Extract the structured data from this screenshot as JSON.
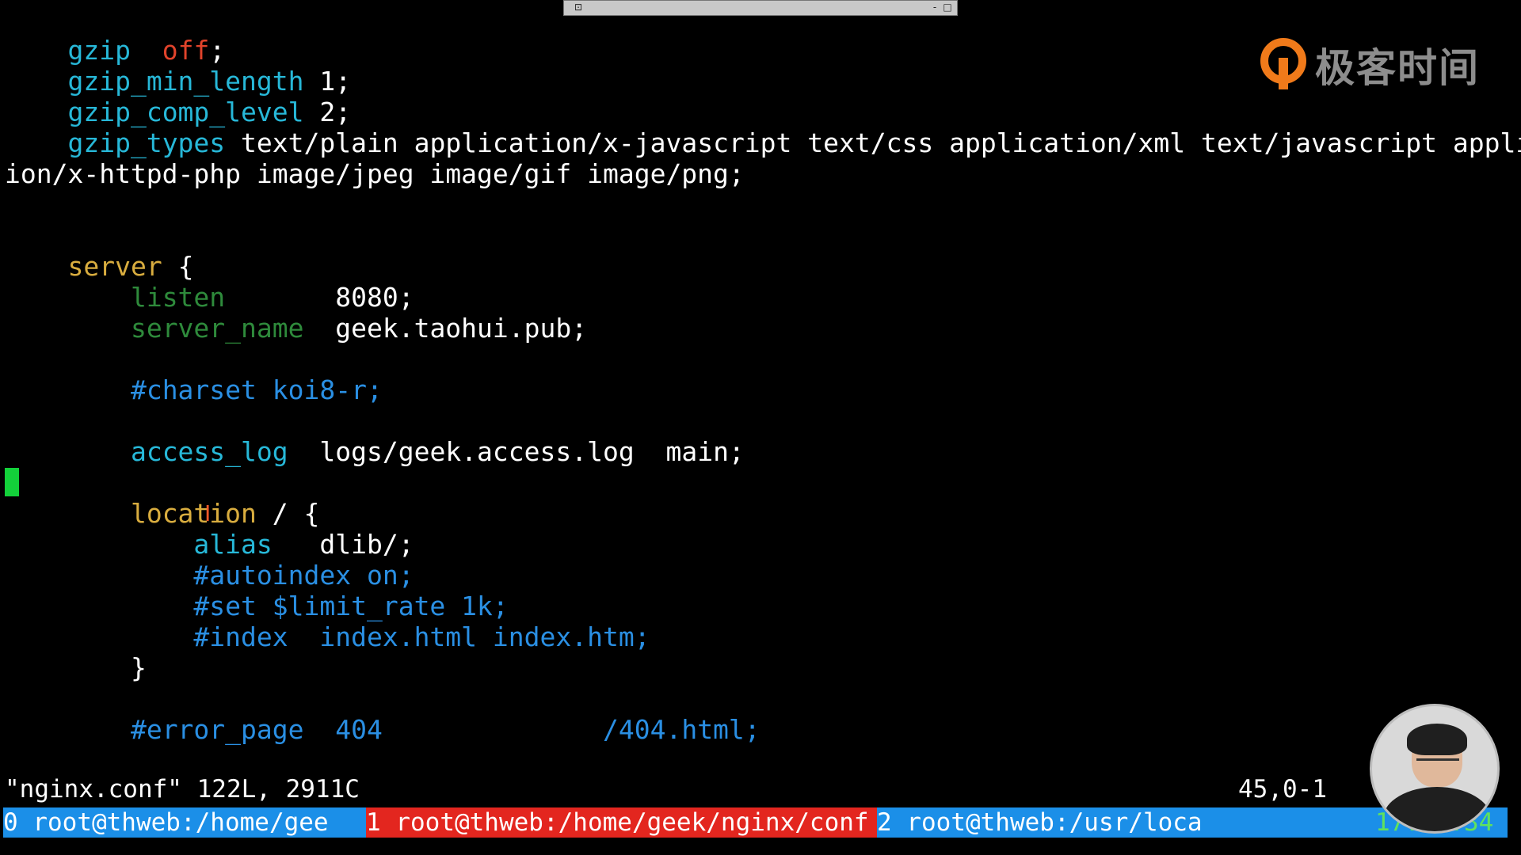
{
  "window": {
    "title_buttons": [
      "⊡",
      "-",
      "□"
    ]
  },
  "watermark": {
    "brand": "极客时间"
  },
  "colors": {
    "directive": "#27b8d8",
    "value_off": "#e0432b",
    "block": "#d9ad3f",
    "dim_directive": "#2e8a3b",
    "comment": "#2a8fe3",
    "cursor": "#13d13a",
    "tab_active": "#e3261f",
    "tab_inactive": "#1b8fe8",
    "clock": "#60e25d"
  },
  "editor": {
    "lines": [
      {
        "indent": "    ",
        "parts": [
          {
            "t": "gzip",
            "c": "kw-cyan"
          },
          {
            "t": "  ",
            "c": "plain"
          },
          {
            "t": "off",
            "c": "kw-red"
          },
          {
            "t": ";",
            "c": "plain"
          }
        ]
      },
      {
        "indent": "    ",
        "parts": [
          {
            "t": "gzip_min_length",
            "c": "kw-cyan"
          },
          {
            "t": " 1;",
            "c": "plain"
          }
        ]
      },
      {
        "indent": "    ",
        "parts": [
          {
            "t": "gzip_comp_level",
            "c": "kw-cyan"
          },
          {
            "t": " 2;",
            "c": "plain"
          }
        ]
      },
      {
        "indent": "    ",
        "parts": [
          {
            "t": "gzip_types",
            "c": "kw-cyan"
          },
          {
            "t": " text/plain application/x-javascript text/css application/xml text/javascript applicat",
            "c": "plain"
          }
        ]
      },
      {
        "indent": "",
        "parts": [
          {
            "t": "ion/x-httpd-php image/jpeg image/gif image/png;",
            "c": "plain"
          }
        ]
      },
      {
        "indent": "",
        "parts": []
      },
      {
        "indent": "",
        "parts": []
      },
      {
        "indent": "    ",
        "parts": [
          {
            "t": "server",
            "c": "kw-yellow"
          },
          {
            "t": " {",
            "c": "plain"
          }
        ]
      },
      {
        "indent": "        ",
        "parts": [
          {
            "t": "listen",
            "c": "kw-green"
          },
          {
            "t": "       8080;",
            "c": "plain"
          }
        ]
      },
      {
        "indent": "        ",
        "parts": [
          {
            "t": "server_name",
            "c": "kw-green"
          },
          {
            "t": "  geek.taohui.pub;",
            "c": "plain"
          }
        ]
      },
      {
        "indent": "",
        "parts": []
      },
      {
        "indent": "        ",
        "parts": [
          {
            "t": "#charset koi8-r;",
            "c": "comment"
          }
        ]
      },
      {
        "indent": "",
        "parts": []
      },
      {
        "indent": "        ",
        "parts": [
          {
            "t": "access_log",
            "c": "kw-cyan"
          },
          {
            "t": "  logs/geek.access.log  main;",
            "c": "plain"
          }
        ]
      },
      {
        "indent": "",
        "parts": []
      },
      {
        "indent": "        ",
        "parts": [
          {
            "t": "location",
            "c": "kw-yellow"
          },
          {
            "t": " / {",
            "c": "plain"
          }
        ]
      },
      {
        "indent": "            ",
        "parts": [
          {
            "t": "alias",
            "c": "kw-cyan"
          },
          {
            "t": "   dlib/;",
            "c": "plain"
          }
        ]
      },
      {
        "indent": "            ",
        "parts": [
          {
            "t": "#autoindex on;",
            "c": "comment"
          }
        ]
      },
      {
        "indent": "            ",
        "parts": [
          {
            "t": "#set $limit_rate 1k;",
            "c": "comment"
          }
        ]
      },
      {
        "indent": "            ",
        "parts": [
          {
            "t": "#index  index.html index.htm;",
            "c": "comment"
          }
        ]
      },
      {
        "indent": "        ",
        "parts": [
          {
            "t": "}",
            "c": "plain"
          }
        ]
      },
      {
        "indent": "",
        "parts": []
      },
      {
        "indent": "        ",
        "parts": [
          {
            "t": "#error_page  404              /404.html;",
            "c": "comment"
          }
        ]
      }
    ]
  },
  "status": {
    "message": "\"nginx.conf\" 122L, 2911C",
    "position": "45,0-1"
  },
  "tmux": {
    "tabs": [
      {
        "label": "0 root@thweb:/home/gee"
      },
      {
        "label": "1 root@thweb:/home/geek/nginx/conf"
      },
      {
        "label": "2 root@thweb:/usr/loca"
      }
    ],
    "clock": "17:59:34"
  }
}
